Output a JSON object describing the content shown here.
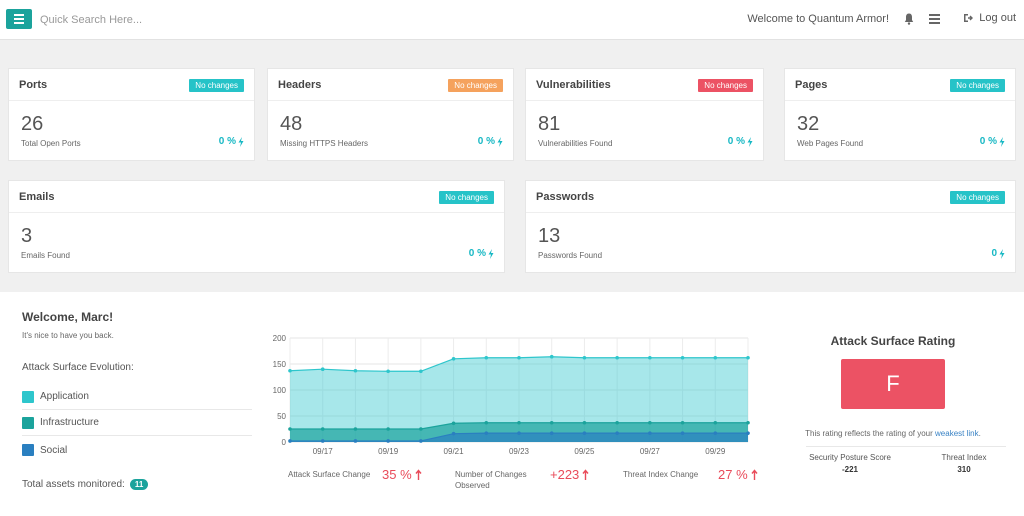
{
  "topbar": {
    "search_placeholder": "Quick Search Here...",
    "welcome": "Welcome to Quantum Armor!",
    "logout": "Log out"
  },
  "cards": [
    {
      "title": "Ports",
      "badge": "No changes",
      "badge_color": "#26c3c8",
      "value": "26",
      "sub": "Total Open Ports",
      "pct": "0 %"
    },
    {
      "title": "Headers",
      "badge": "No changes",
      "badge_color": "#f5a25d",
      "value": "48",
      "sub": "Missing HTTPS Headers",
      "pct": "0 %"
    },
    {
      "title": "Vulnerabilities",
      "badge": "No changes",
      "badge_color": "#ec5264",
      "value": "81",
      "sub": "Vulnerabilities Found",
      "pct": "0 %"
    },
    {
      "title": "Pages",
      "badge": "No changes",
      "badge_color": "#26c3c8",
      "value": "32",
      "sub": "Web Pages Found",
      "pct": "0 %"
    },
    {
      "title": "Emails",
      "badge": "No changes",
      "badge_color": "#26c3c8",
      "value": "3",
      "sub": "Emails Found",
      "pct": "0 %"
    },
    {
      "title": "Passwords",
      "badge": "No changes",
      "badge_color": "#26c3c8",
      "value": "13",
      "sub": "Passwords Found",
      "pct": "0"
    }
  ],
  "welcome": {
    "title": "Welcome, Marc!",
    "sub": "It's nice to have you back.",
    "evolution_label": "Attack Surface Evolution:",
    "legend": [
      {
        "name": "Application",
        "color": "#2ec6cc"
      },
      {
        "name": "Infrastructure",
        "color": "#1ba39c"
      },
      {
        "name": "Social",
        "color": "#2a7fc0"
      }
    ],
    "assets_label": "Total assets monitored:",
    "assets_count": "11"
  },
  "chart_data": {
    "type": "area",
    "x": [
      "09/16",
      "09/17",
      "09/18",
      "09/19",
      "09/20",
      "09/21",
      "09/22",
      "09/23",
      "09/24",
      "09/25",
      "09/26",
      "09/27",
      "09/28",
      "09/29",
      "09/30"
    ],
    "x_tick_labels": [
      "09/17",
      "09/19",
      "09/21",
      "09/23",
      "09/25",
      "09/27",
      "09/29"
    ],
    "ylim": [
      0,
      200
    ],
    "y_ticks": [
      0,
      50,
      100,
      150,
      200
    ],
    "grid": true,
    "series": [
      {
        "color": "#2ec6cc",
        "values": [
          137,
          140,
          137,
          136,
          136,
          160,
          162,
          162,
          164,
          162,
          162,
          162,
          162,
          162,
          162
        ]
      },
      {
        "color": "#1ba39c",
        "values": [
          25,
          25,
          25,
          25,
          25,
          36,
          37,
          37,
          37,
          37,
          37,
          37,
          37,
          37,
          37
        ]
      },
      {
        "color": "#2a7fc0",
        "values": [
          2,
          2,
          2,
          2,
          2,
          16,
          17,
          17,
          17,
          17,
          17,
          17,
          17,
          17,
          17
        ]
      }
    ]
  },
  "stats": [
    {
      "label": "Attack Surface Change",
      "value": "35 %"
    },
    {
      "label": "Number of Changes Observed",
      "value": "+223"
    },
    {
      "label": "Threat Index Change",
      "value": "27 %"
    }
  ],
  "rating": {
    "title": "Attack Surface Rating",
    "grade": "F",
    "note": "This rating reflects the rating of your",
    "link": "weakest link",
    "note_end": ".",
    "posture_label": "Security Posture Score",
    "posture_value": "-221",
    "threat_label": "Threat Index",
    "threat_value": "310"
  }
}
